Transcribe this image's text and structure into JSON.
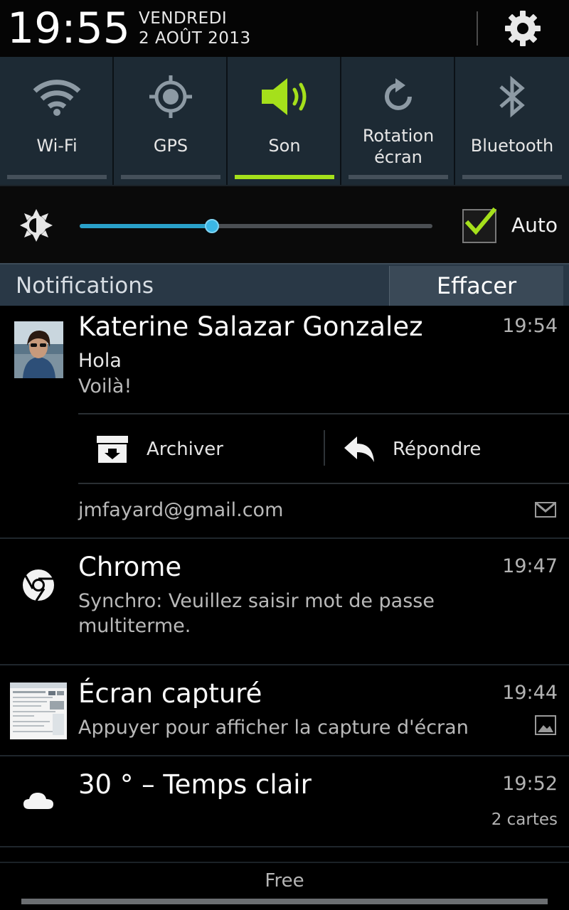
{
  "header": {
    "time": "19:55",
    "day": "VENDREDI",
    "date": "2 AOÛT 2013"
  },
  "toggles": [
    {
      "label": "Wi-Fi",
      "icon": "wifi-icon",
      "on": false
    },
    {
      "label": "GPS",
      "icon": "gps-icon",
      "on": false
    },
    {
      "label": "Son",
      "icon": "sound-icon",
      "on": true
    },
    {
      "label_line1": "Rotation",
      "label_line2": "écran",
      "icon": "rotation-icon",
      "on": false
    },
    {
      "label": "Bluetooth",
      "icon": "bluetooth-icon",
      "on": false
    }
  ],
  "brightness": {
    "level": 0.375,
    "auto_label": "Auto",
    "auto_checked": true
  },
  "notifications_header": {
    "title": "Notifications",
    "clear_label": "Effacer"
  },
  "notifications": {
    "gmail": {
      "sender": "Katerine Salazar Gonzalez",
      "time": "19:54",
      "subject": "Hola",
      "snippet": "Voilà!",
      "archive_label": "Archiver",
      "reply_label": "Répondre",
      "account": "jmfayard@gmail.com"
    },
    "chrome": {
      "title": "Chrome",
      "time": "19:47",
      "text": "Synchro: Veuillez saisir mot de passe multiterme."
    },
    "screenshot": {
      "title": "Écran capturé",
      "time": "19:44",
      "text": "Appuyer pour afficher la capture d'écran"
    },
    "weather": {
      "title": "30 ° – Temps clair",
      "time": "19:52",
      "cards": "2 cartes"
    }
  },
  "footer": {
    "carrier": "Free"
  },
  "colors": {
    "accent_green": "#a5e01b",
    "slider_blue": "#2aa1c9",
    "toggle_bg": "#1d2a34",
    "header_bar": "#293846"
  }
}
